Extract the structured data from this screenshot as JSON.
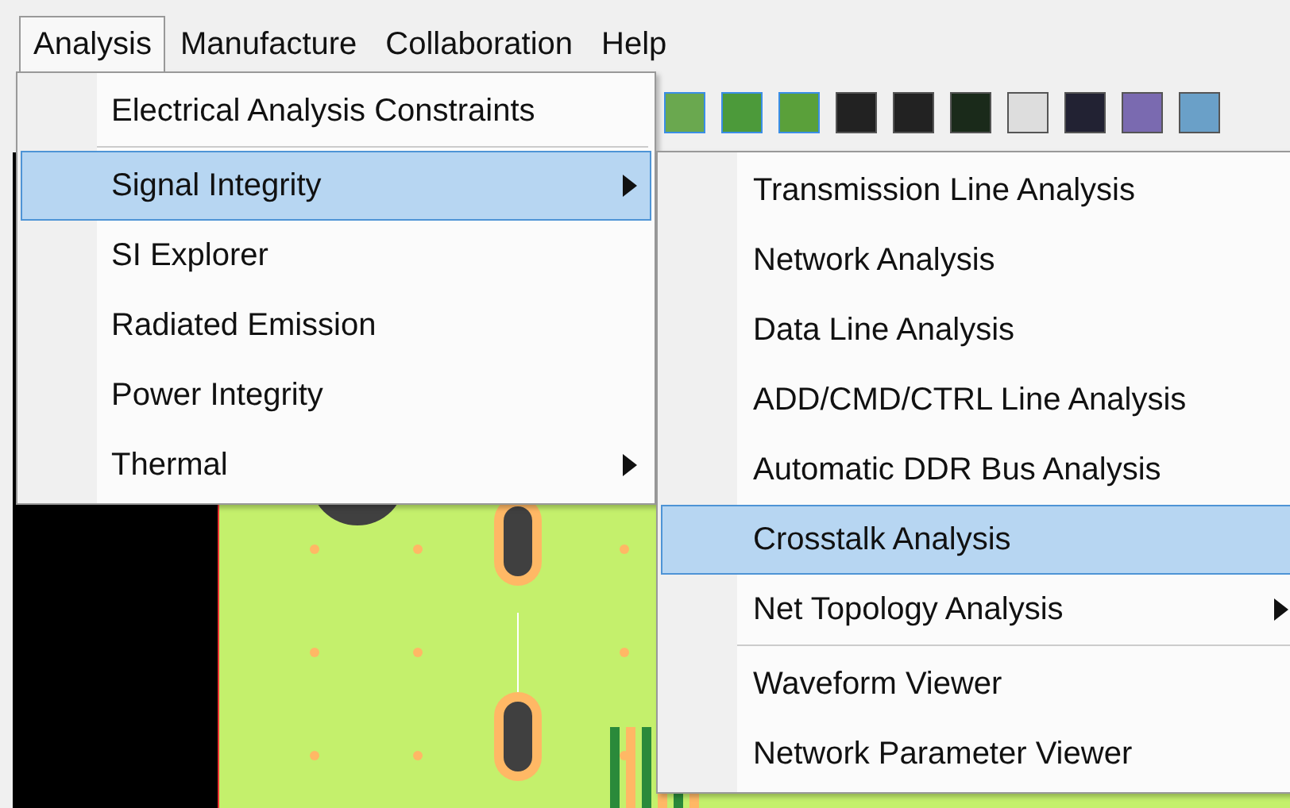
{
  "menubar": [
    {
      "label": "Analysis",
      "selected": true
    },
    {
      "label": "Manufacture",
      "selected": false
    },
    {
      "label": "Collaboration",
      "selected": false
    },
    {
      "label": "Help",
      "selected": false
    }
  ],
  "analysis_menu": [
    {
      "kind": "item",
      "label": "Electrical Analysis Constraints",
      "selected": false,
      "has_submenu": false
    },
    {
      "kind": "separator"
    },
    {
      "kind": "item",
      "label": "Signal Integrity",
      "selected": true,
      "has_submenu": true
    },
    {
      "kind": "item",
      "label": "SI Explorer",
      "selected": false,
      "has_submenu": false
    },
    {
      "kind": "item",
      "label": "Radiated Emission",
      "selected": false,
      "has_submenu": false
    },
    {
      "kind": "item",
      "label": "Power Integrity",
      "selected": false,
      "has_submenu": false
    },
    {
      "kind": "item",
      "label": "Thermal",
      "selected": false,
      "has_submenu": true
    }
  ],
  "signal_integrity_menu": [
    {
      "kind": "item",
      "label": "Transmission Line Analysis",
      "selected": false,
      "has_submenu": false
    },
    {
      "kind": "item",
      "label": "Network Analysis",
      "selected": false,
      "has_submenu": false
    },
    {
      "kind": "item",
      "label": "Data Line Analysis",
      "selected": false,
      "has_submenu": false
    },
    {
      "kind": "item",
      "label": "ADD/CMD/CTRL Line Analysis",
      "selected": false,
      "has_submenu": false
    },
    {
      "kind": "item",
      "label": "Automatic DDR Bus Analysis",
      "selected": false,
      "has_submenu": false
    },
    {
      "kind": "item",
      "label": "Crosstalk Analysis",
      "selected": true,
      "has_submenu": false
    },
    {
      "kind": "item",
      "label": "Net Topology Analysis",
      "selected": false,
      "has_submenu": true
    },
    {
      "kind": "separator"
    },
    {
      "kind": "item",
      "label": "Waveform Viewer",
      "selected": false,
      "has_submenu": false
    },
    {
      "kind": "item",
      "label": "Network Parameter Viewer",
      "selected": false,
      "has_submenu": false
    }
  ]
}
